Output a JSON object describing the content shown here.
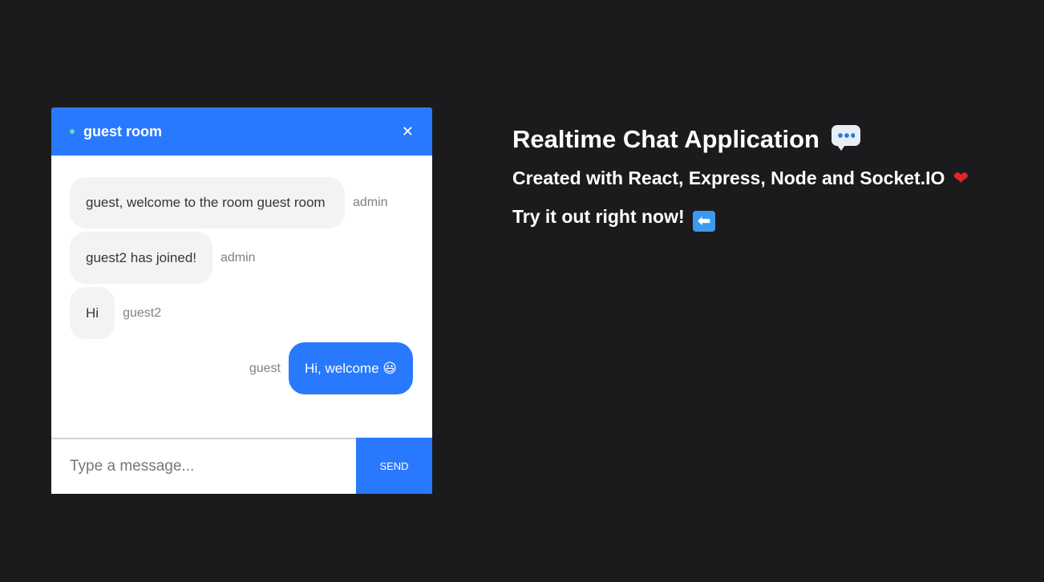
{
  "chat": {
    "room_name": "guest room",
    "close_label": "✕",
    "messages": [
      {
        "text": "guest, welcome to the room guest room",
        "sender": "admin"
      },
      {
        "text": "guest2 has joined!",
        "sender": "admin"
      },
      {
        "text": "Hi",
        "sender": "guest2"
      },
      {
        "text": "Hi, welcome 😃",
        "sender": "guest"
      }
    ],
    "input": {
      "placeholder": "Type a message...",
      "value": ""
    },
    "send_label": "send"
  },
  "info": {
    "title": "Realtime Chat Application",
    "subtitle": "Created with React, Express, Node and Socket.IO",
    "cta": "Try it out right now!",
    "heart": "❤",
    "arrow": "⬅"
  },
  "colors": {
    "background": "#1b1b1d",
    "accent": "#2979ff",
    "bubble": "#f3f3f3",
    "online": "#5fe3a5"
  }
}
